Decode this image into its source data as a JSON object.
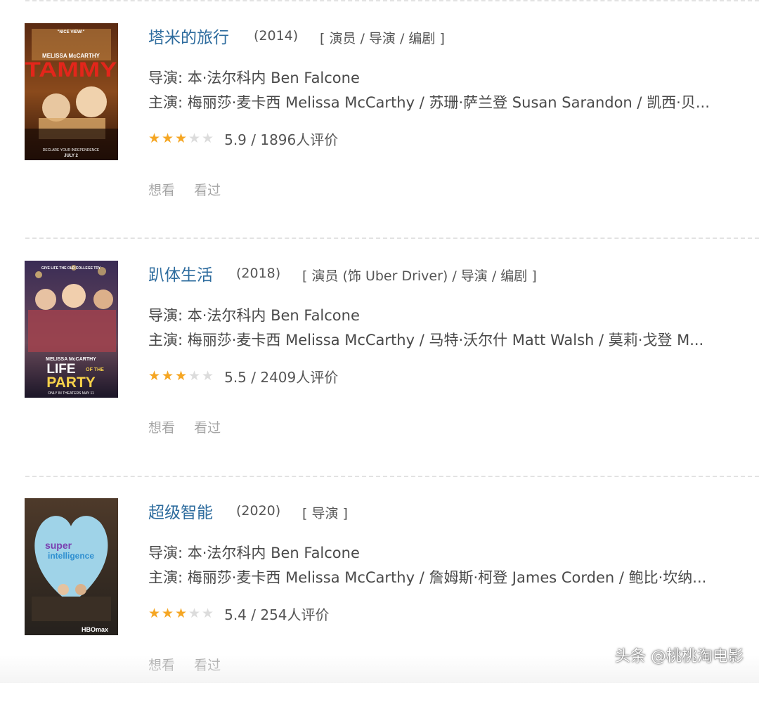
{
  "movies": [
    {
      "title": "塔米的旅行",
      "year": "(2014)",
      "roles": "[ 演员 / 导演 / 编剧 ]",
      "director_line": "导演: 本·法尔科内 Ben Falcone",
      "cast_line": "主演: 梅丽莎·麦卡西 Melissa McCarthy / 苏珊·萨兰登 Susan Sarandon / 凯西·贝...",
      "rating_stars": 3,
      "rating_text": "5.9 / 1896人评价",
      "want_label": "想看",
      "seen_label": "看过",
      "poster": {
        "tagline": "\"NICE VIEW!\"",
        "actor": "MELISSA McCARTHY",
        "name": "TAMMY",
        "footer1": "DECLARE YOUR INDEPENDENCE",
        "footer2": "JULY 2"
      }
    },
    {
      "title": "趴体生活",
      "year": "(2018)",
      "roles": "[ 演员 (饰 Uber Driver) / 导演 / 编剧 ]",
      "director_line": "导演: 本·法尔科内 Ben Falcone",
      "cast_line": "主演: 梅丽莎·麦卡西 Melissa McCarthy / 马特·沃尔什 Matt Walsh / 莫莉·戈登 M...",
      "rating_stars": 3,
      "rating_text": "5.5 / 2409人评价",
      "want_label": "想看",
      "seen_label": "看过",
      "poster": {
        "tagline": "GIVE LIFE THE OLD COLLEGE TRY",
        "actor": "MELISSA McCARTHY",
        "name1": "LIFE",
        "name2": "OF THE",
        "name3": "PARTY",
        "footer1": "ONLY IN THEATERS MAY 11"
      }
    },
    {
      "title": "超级智能",
      "year": "(2020)",
      "roles": "[ 导演 ]",
      "director_line": "导演: 本·法尔科内 Ben Falcone",
      "cast_line": "主演: 梅丽莎·麦卡西 Melissa McCarthy / 詹姆斯·柯登 James Corden / 鲍比·坎纳...",
      "rating_stars": 3,
      "rating_text": "5.4 / 254人评价",
      "want_label": "想看",
      "seen_label": "看过",
      "poster": {
        "name1": "super",
        "name2": "intelligence",
        "footer1": "HBOmax"
      }
    }
  ],
  "watermark": "头条 @桃桃淘电影",
  "colors": {
    "title_link": "#2e6c9e",
    "star_on": "#f5a623",
    "star_off": "#dcdcdc",
    "separator": "#e2e2e2",
    "action_text": "#a6a6a6"
  }
}
